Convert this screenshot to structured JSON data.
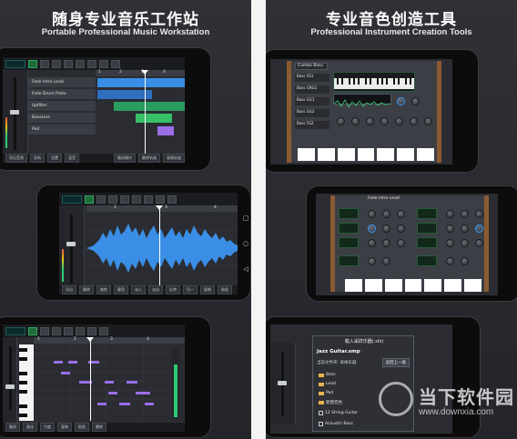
{
  "left_panel": {
    "title": "随身专业音乐工作站",
    "subtitle": "Portable Professional Music Workstation"
  },
  "right_panel": {
    "title": "专业音色创造工具",
    "subtitle": "Professional Instrument Creation Tools"
  },
  "daw": {
    "ruler_marks": [
      "1",
      "2",
      "3",
      "4"
    ],
    "tracks": [
      "Fade Intro Lead",
      "Fade Drum Proto",
      "Upfilter",
      "BassLine",
      "Pad"
    ],
    "bottom_buttons": [
      "导出音频",
      "导轨",
      "设置",
      "混音"
    ],
    "bottom_buttons_right": [
      "撤消操作",
      "删除轨道",
      "复制轨道"
    ]
  },
  "audio_editor": {
    "ruler_marks": [
      "2",
      "3",
      "4"
    ],
    "bottom_buttons": [
      "导出",
      "删除",
      "裁剪",
      "静音",
      "淡入",
      "淡出",
      "反转",
      "归一",
      "复制",
      "粘贴"
    ]
  },
  "piano_roll": {
    "ruler_marks": [
      "1",
      "2",
      "3",
      "4"
    ],
    "bottom_buttons": [
      "撤消",
      "量化",
      "力度",
      "复制",
      "粘贴",
      "删除"
    ]
  },
  "synth1": {
    "preset_name": "Combo Bass",
    "slots": [
      "Bass FG1",
      "Bass GRG1",
      "Bass GG1",
      "Bass GG2",
      "Bass FG2"
    ]
  },
  "synth2": {
    "preset_name": "Fade Intro Lead"
  },
  "dialog": {
    "title": "载入采样乐器(.sfz)",
    "current": "Jazz Guitar.smp",
    "path": "当前文件夹: 采样乐器",
    "back_button": "返回上一级",
    "items": [
      "Bass",
      "Lead",
      "Pad",
      "新建音色",
      "12 String Guitar",
      "Acoustic Bass"
    ]
  },
  "watermark": {
    "text": "当下软件园",
    "url": "www.downxia.com"
  },
  "colors": {
    "background": "#23252a",
    "accent_blue": "#3a8ee6",
    "accent_green": "#2ecc71",
    "accent_purple": "#9b6ee8"
  }
}
